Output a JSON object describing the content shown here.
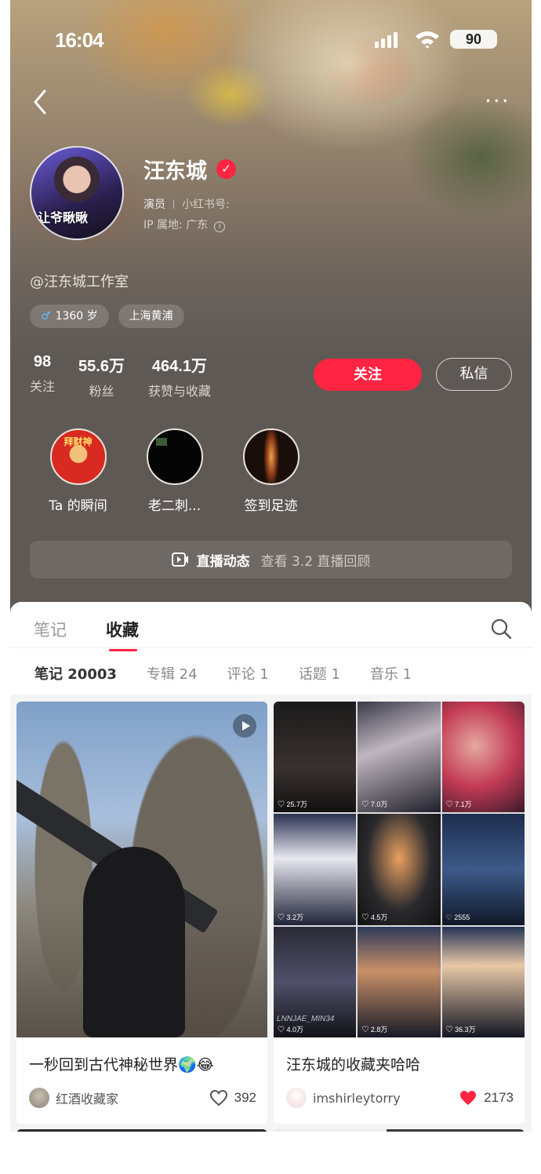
{
  "status_bar": {
    "time": "16:04",
    "battery": "90"
  },
  "profile": {
    "name": "汪东城",
    "verified_mark": "✓",
    "avatar_text": "让爷瞅瞅",
    "occupation": "演员",
    "redbook_id_label": "小红书号:",
    "ip_location": "IP 属地: 广东",
    "info_icon": "i",
    "mention": "@汪东城工作室",
    "tags": [
      {
        "icon": "male-icon",
        "text": "1360 岁"
      },
      {
        "text": "上海黄浦"
      }
    ]
  },
  "stats": [
    {
      "value": "98",
      "label": "关注"
    },
    {
      "value": "55.6万",
      "label": "粉丝"
    },
    {
      "value": "464.1万",
      "label": "获赞与收藏"
    }
  ],
  "actions": {
    "follow": "关注",
    "message": "私信"
  },
  "highlights": [
    {
      "label": "Ta 的瞬间",
      "badge": "拜财神"
    },
    {
      "label": "老二刺..."
    },
    {
      "label": "签到足迹"
    }
  ],
  "live": {
    "title": "直播动态",
    "subtitle": "查看 3.2 直播回顾"
  },
  "tabs": [
    {
      "label": "笔记",
      "active": false
    },
    {
      "label": "收藏",
      "active": true
    }
  ],
  "subtabs": [
    {
      "label": "笔记 20003",
      "active": true
    },
    {
      "label": "专辑 24"
    },
    {
      "label": "评论 1"
    },
    {
      "label": "话题 1"
    },
    {
      "label": "音乐 1"
    }
  ],
  "cards": [
    {
      "title": "一秒回到古代神秘世界🌍😂",
      "author": "红酒收藏家",
      "likes": "392",
      "liked": false,
      "video": true
    },
    {
      "title": "汪东城的收藏夹哈哈",
      "author": "imshirleytorry",
      "likes": "2173",
      "liked": true,
      "tile_likes": [
        "25.7万",
        "7.0万",
        "7.1万",
        "3.2万",
        "4.5万",
        "2555",
        "4.0万",
        "2.8万",
        "36.3万"
      ],
      "watermark": "LNNJAE_MIN34"
    }
  ],
  "colors": {
    "accent": "#ff2442",
    "verified": "#ff2442",
    "header_bg": "#5f5955"
  }
}
